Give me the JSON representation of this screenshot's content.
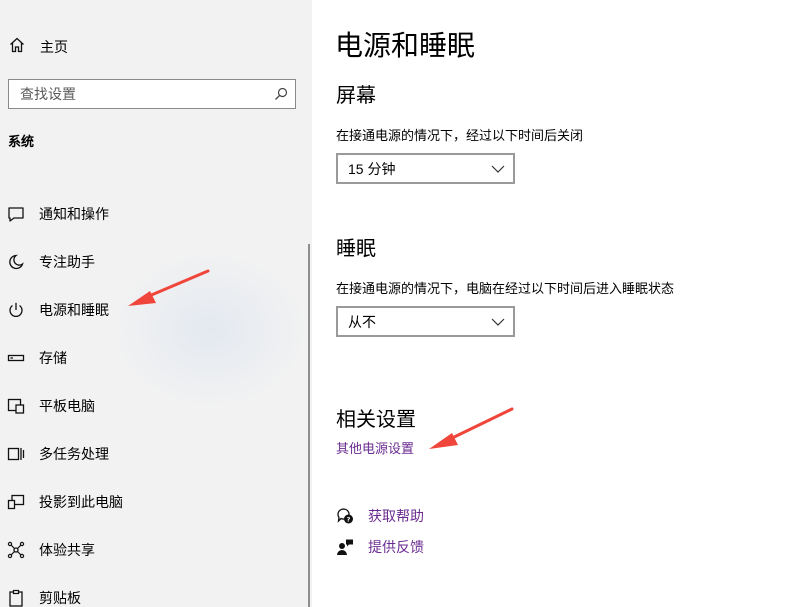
{
  "sidebar": {
    "home_label": "主页",
    "search_placeholder": "查找设置",
    "section_title": "系统",
    "items": [
      {
        "label": "通知和操作",
        "icon": "notification-icon"
      },
      {
        "label": "专注助手",
        "icon": "moon-icon"
      },
      {
        "label": "电源和睡眠",
        "icon": "power-icon"
      },
      {
        "label": "存储",
        "icon": "storage-icon"
      },
      {
        "label": "平板电脑",
        "icon": "tablet-icon"
      },
      {
        "label": "多任务处理",
        "icon": "multitasking-icon"
      },
      {
        "label": "投影到此电脑",
        "icon": "projection-icon"
      },
      {
        "label": "体验共享",
        "icon": "share-icon"
      },
      {
        "label": "剪贴板",
        "icon": "clipboard-icon"
      }
    ]
  },
  "main": {
    "title": "电源和睡眠",
    "screen": {
      "heading": "屏幕",
      "description": "在接通电源的情况下，经过以下时间后关闭",
      "value": "15 分钟"
    },
    "sleep": {
      "heading": "睡眠",
      "description": "在接通电源的情况下，电脑在经过以下时间后进入睡眠状态",
      "value": "从不"
    },
    "related": {
      "heading": "相关设置",
      "link": "其他电源设置"
    },
    "help": {
      "get_help": "获取帮助",
      "feedback": "提供反馈"
    }
  },
  "colors": {
    "link": "#6b2c91",
    "arrow": "#f0453a",
    "sidebar_bg": "#f2f2f2"
  }
}
